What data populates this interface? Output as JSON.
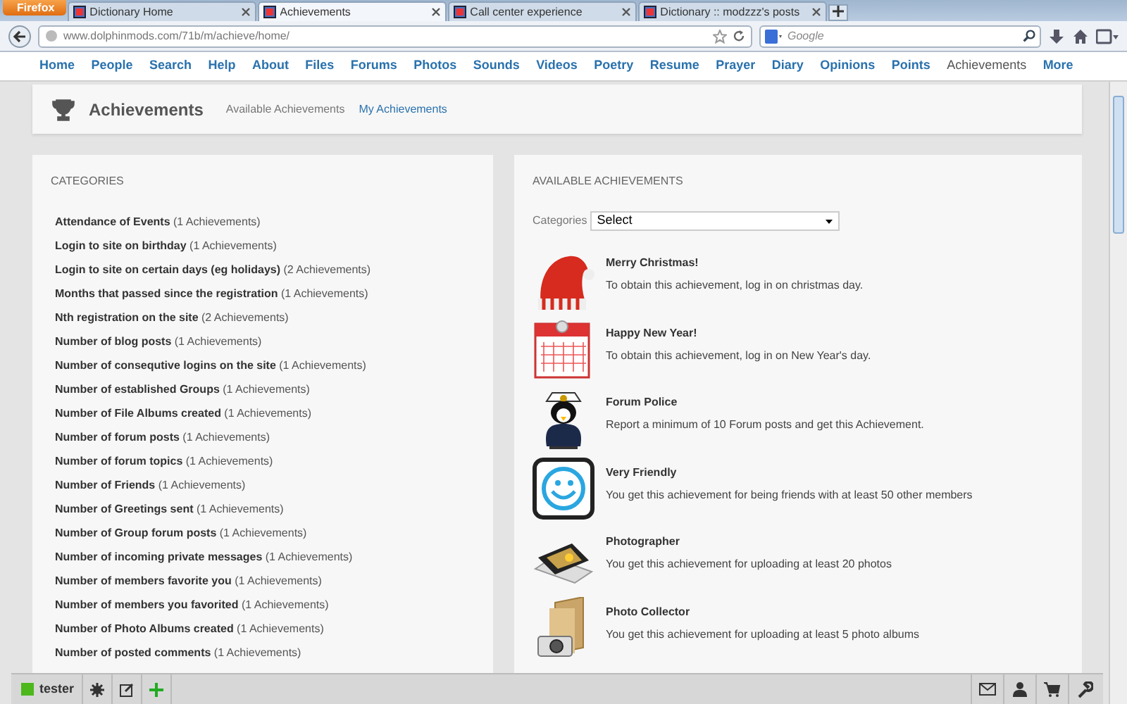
{
  "browser": {
    "menu_button": "Firefox",
    "tabs": [
      {
        "title": "Dictionary Home",
        "selected": false
      },
      {
        "title": "Achievements",
        "selected": true
      },
      {
        "title": "Call center experience",
        "selected": false
      },
      {
        "title": "Dictionary :: modzzz's posts",
        "selected": false
      }
    ],
    "address": "www.dolphinmods.com/71b/m/achieve/home/",
    "search": {
      "placeholder": "Google"
    }
  },
  "site_nav": [
    {
      "label": "Home",
      "selected": false
    },
    {
      "label": "People",
      "selected": false
    },
    {
      "label": "Search",
      "selected": false
    },
    {
      "label": "Help",
      "selected": false
    },
    {
      "label": "About",
      "selected": false
    },
    {
      "label": "Files",
      "selected": false
    },
    {
      "label": "Forums",
      "selected": false
    },
    {
      "label": "Photos",
      "selected": false
    },
    {
      "label": "Sounds",
      "selected": false
    },
    {
      "label": "Videos",
      "selected": false
    },
    {
      "label": "Poetry",
      "selected": false
    },
    {
      "label": "Resume",
      "selected": false
    },
    {
      "label": "Prayer",
      "selected": false
    },
    {
      "label": "Diary",
      "selected": false
    },
    {
      "label": "Opinions",
      "selected": false
    },
    {
      "label": "Points",
      "selected": false
    },
    {
      "label": "Achievements",
      "selected": true
    },
    {
      "label": "More",
      "selected": false
    }
  ],
  "page_header": {
    "title": "Achievements",
    "links": [
      {
        "label": "Available Achievements",
        "selected": true
      },
      {
        "label": "My Achievements",
        "selected": false
      }
    ]
  },
  "categories": {
    "title": "CATEGORIES",
    "items": [
      {
        "name": "Attendance of Events",
        "count": "(1 Achievements)"
      },
      {
        "name": "Login to site on birthday",
        "count": "(1 Achievements)"
      },
      {
        "name": "Login to site on certain days (eg holidays)",
        "count": "(2 Achievements)"
      },
      {
        "name": "Months that passed since the registration",
        "count": "(1 Achievements)"
      },
      {
        "name": "Nth registration on the site",
        "count": "(2 Achievements)"
      },
      {
        "name": "Number of blog posts",
        "count": "(1 Achievements)"
      },
      {
        "name": "Number of consequtive logins on the site",
        "count": "(1 Achievements)"
      },
      {
        "name": "Number of established Groups",
        "count": "(1 Achievements)"
      },
      {
        "name": "Number of File Albums created",
        "count": "(1 Achievements)"
      },
      {
        "name": "Number of forum posts",
        "count": "(1 Achievements)"
      },
      {
        "name": "Number of forum topics",
        "count": "(1 Achievements)"
      },
      {
        "name": "Number of Friends",
        "count": "(1 Achievements)"
      },
      {
        "name": "Number of Greetings sent",
        "count": "(1 Achievements)"
      },
      {
        "name": "Number of Group forum posts",
        "count": "(1 Achievements)"
      },
      {
        "name": "Number of incoming private messages",
        "count": "(1 Achievements)"
      },
      {
        "name": "Number of members favorite you",
        "count": "(1 Achievements)"
      },
      {
        "name": "Number of members you favorited",
        "count": "(1 Achievements)"
      },
      {
        "name": "Number of Photo Albums created",
        "count": "(1 Achievements)"
      },
      {
        "name": "Number of posted comments",
        "count": "(1 Achievements)"
      }
    ]
  },
  "available": {
    "title": "AVAILABLE ACHIEVEMENTS",
    "filter": {
      "label": "Categories",
      "value": "Select"
    },
    "achievements": [
      {
        "kind": "hat",
        "title": "Merry Christmas!",
        "description": "To obtain this achievement, log in on christmas day."
      },
      {
        "kind": "calendar",
        "title": "Happy New Year!",
        "description": "To obtain this achievement, log in on New Year's day."
      },
      {
        "kind": "penguin",
        "title": "Forum Police",
        "description": "Report a minimum of 10 Forum posts and get this Achievement."
      },
      {
        "kind": "smiley",
        "title": "Very Friendly",
        "description": "You get this achievement for being friends with at least 50 other members"
      },
      {
        "kind": "photos",
        "title": "Photographer",
        "description": "You get this achievement for uploading at least 20 photos"
      },
      {
        "kind": "folder",
        "title": "Photo Collector",
        "description": "You get this achievement for uploading at least 5 photo albums"
      }
    ]
  },
  "toolbar": {
    "user": "tester"
  }
}
